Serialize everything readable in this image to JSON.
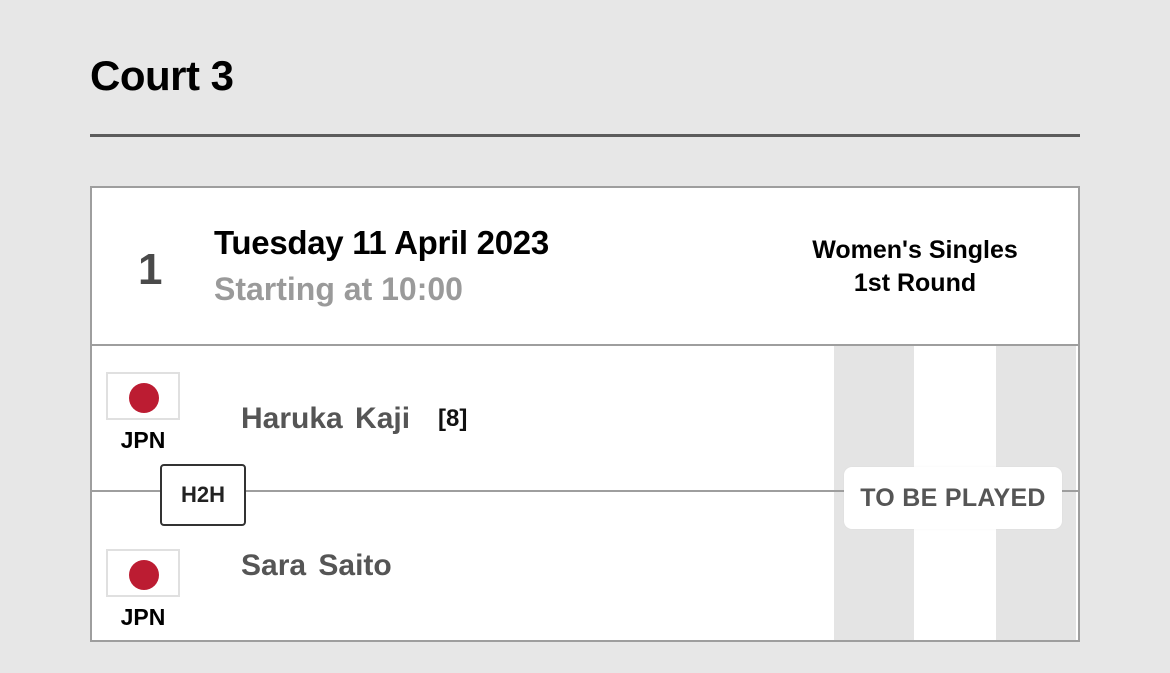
{
  "court": {
    "title": "Court 3"
  },
  "match": {
    "number": "1",
    "date": "Tuesday 11 April 2023",
    "start": "Starting at 10:00",
    "event_line1": "Women's Singles",
    "event_line2": "1st Round",
    "status": "TO BE PLAYED",
    "h2h_label": "H2H"
  },
  "players": [
    {
      "name": "Haruka  Kaji",
      "seed": "[8]",
      "country": "JPN",
      "flag": "japan-flag"
    },
    {
      "name": "Sara  Saito",
      "seed": "",
      "country": "JPN",
      "flag": "japan-flag"
    }
  ],
  "colors": {
    "background": "#e7e7e7",
    "flag_red": "#bc1c32",
    "muted_text": "#9a9a9a"
  }
}
